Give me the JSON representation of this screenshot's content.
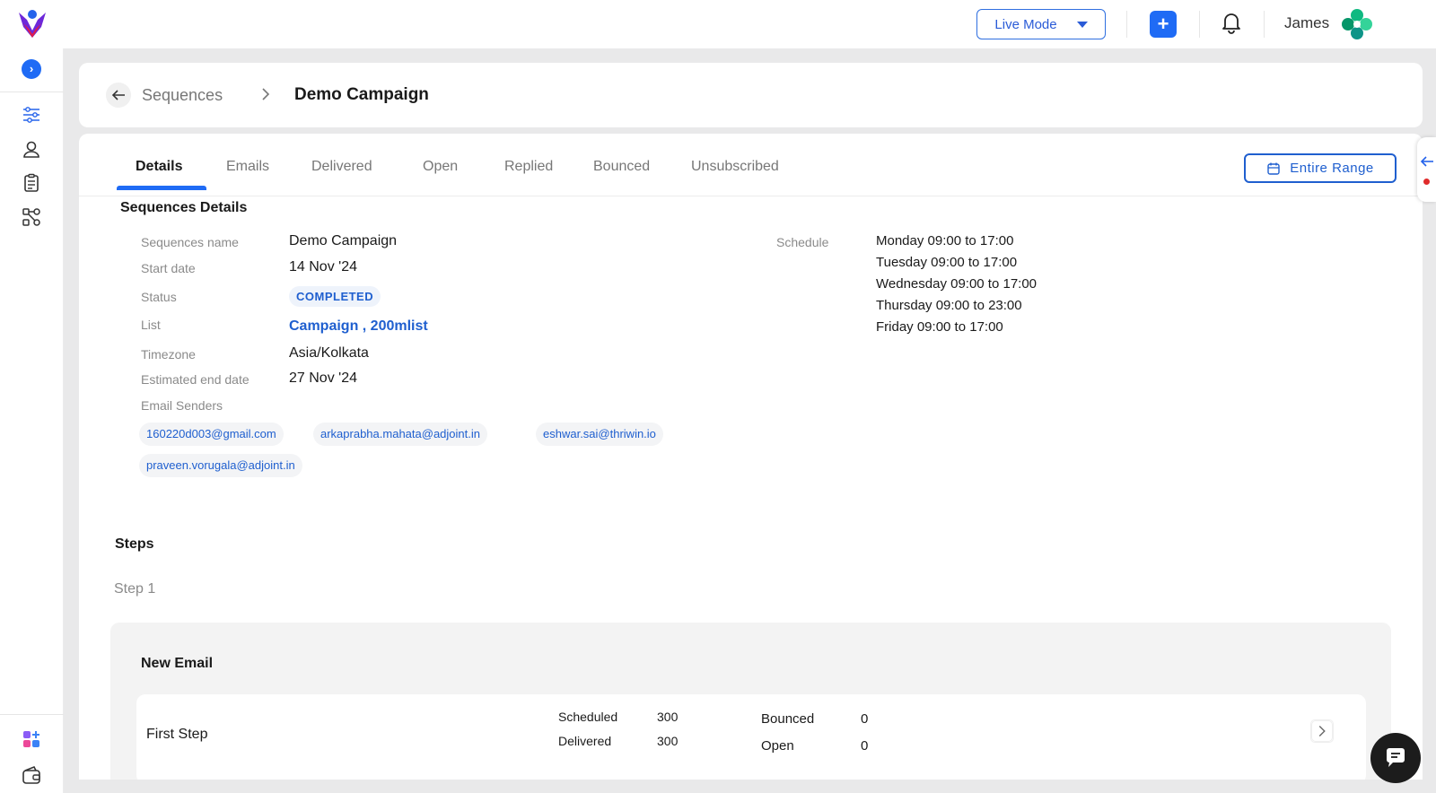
{
  "header": {
    "mode_label": "Live Mode",
    "add_label": "+",
    "user_name": "James"
  },
  "sidebar": {
    "expand_label": "›",
    "items": [
      "sequences-icon",
      "contacts-icon",
      "tasks-icon",
      "workflow-icon",
      "apps-icon",
      "wallet-icon"
    ]
  },
  "breadcrumb": {
    "parent": "Sequences",
    "current": "Demo Campaign"
  },
  "tabs": {
    "items": [
      "Details",
      "Emails",
      "Delivered",
      "Open",
      "Replied",
      "Bounced",
      "Unsubscribed"
    ],
    "active": "Details"
  },
  "range_button": "Entire Range",
  "details": {
    "section_title": "Sequences Details",
    "labels": {
      "name": "Sequences name",
      "start": "Start date",
      "status": "Status",
      "list": "List",
      "timezone": "Timezone",
      "end": "Estimated end date",
      "senders": "Email Senders",
      "schedule": "Schedule"
    },
    "name": "Demo Campaign",
    "start_date": "14 Nov '24",
    "status": "COMPLETED",
    "list": "Campaign , 200mlist",
    "timezone": "Asia/Kolkata",
    "end_date": "27 Nov '24",
    "senders": [
      "160220d003@gmail.com",
      "arkaprabha.mahata@adjoint.in",
      "eshwar.sai@thriwin.io",
      "praveen.vorugala@adjoint.in"
    ],
    "schedule": [
      "Monday 09:00 to 17:00",
      "Tuesday 09:00 to 17:00",
      "Wednesday 09:00 to 17:00",
      "Thursday 09:00 to 23:00",
      "Friday 09:00 to 17:00"
    ]
  },
  "steps": {
    "title": "Steps",
    "step_label": "Step 1",
    "panel_title": "New Email",
    "row": {
      "name": "First Step",
      "scheduled_label": "Scheduled",
      "scheduled_value": "300",
      "delivered_label": "Delivered",
      "delivered_value": "300",
      "bounced_label": "Bounced",
      "bounced_value": "0",
      "open_label": "Open",
      "open_value": "0"
    }
  },
  "colors": {
    "accent": "#1f6bf5",
    "link": "#1f5fcf",
    "background": "#e9e9ea"
  }
}
